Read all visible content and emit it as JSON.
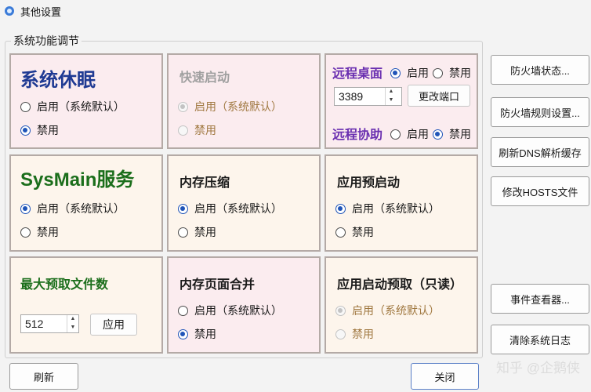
{
  "window": {
    "title": "其他设置"
  },
  "group_title": "系统功能调节",
  "common": {
    "enable_default": "启用（系统默认）",
    "disable": "禁用",
    "enable": "启用"
  },
  "sleep": {
    "title": "系统休眠",
    "title_color": "#1f3a93",
    "selected": "disable"
  },
  "fast_startup": {
    "title": "快速启动",
    "selected": "enable",
    "disabled": true
  },
  "remote_desktop": {
    "title": "远程桌面",
    "title_color": "#6a2fb0",
    "selected": "enable",
    "port": "3389",
    "change_port": "更改端口"
  },
  "remote_assist": {
    "title": "远程协助",
    "title_color": "#6a2fb0",
    "selected": "disable"
  },
  "sysmain": {
    "title": "SysMain服务",
    "title_color": "#1b6e1b",
    "selected": "enable"
  },
  "mem_compress": {
    "title": "内存压缩",
    "selected": "enable"
  },
  "app_prelaunch": {
    "title": "应用预启动",
    "selected": "enable"
  },
  "max_prefetch": {
    "title": "最大预取文件数",
    "value": "512",
    "apply": "应用"
  },
  "page_combine": {
    "title": "内存页面合并",
    "selected": "disable"
  },
  "app_launch_prefetch": {
    "title": "应用启动预取（只读）",
    "selected": "enable",
    "disabled": true
  },
  "side_buttons": [
    "防火墙状态...",
    "防火墙规则设置...",
    "刷新DNS解析缓存",
    "修改HOSTS文件",
    "事件查看器...",
    "清除系统日志"
  ],
  "footer": {
    "refresh": "刷新",
    "close": "关闭"
  },
  "watermark": "知乎 @企鹅侠",
  "colors": {
    "panel_pink": "#fbecef",
    "panel_cream": "#fdf5ec",
    "accent": "#1f54b8"
  }
}
